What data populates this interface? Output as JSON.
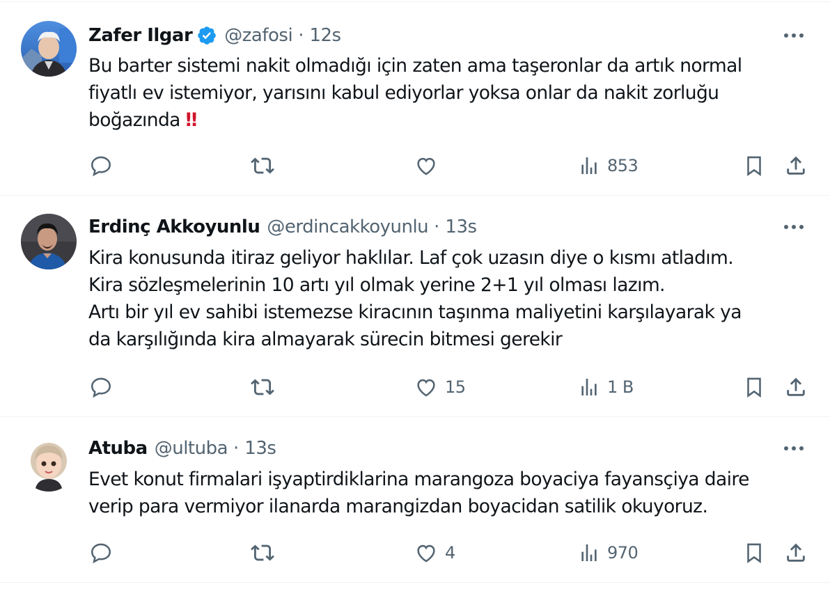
{
  "tweets": [
    {
      "name": "Zafer Ilgar",
      "verified": true,
      "handle": "@zafosi",
      "separator": "·",
      "time": "12s",
      "text": "Bu barter sistemi nakit olmadığı için zaten ama taşeronlar da artık normal\nfiyatlı ev istemiyor, yarısını kabul ediyorlar yoksa onlar da nakit zorluğu\nboğazında ",
      "emoji": "‼",
      "replies": "",
      "reposts": "",
      "likes": "",
      "views": "853"
    },
    {
      "name": "Erdinç Akkoyunlu",
      "verified": false,
      "handle": "@erdincakkoyunlu",
      "separator": "·",
      "time": "13s",
      "text": "Kira konusunda itiraz geliyor haklılar. Laf çok uzasın diye o kısmı atladım.\nKira sözleşmelerinin 10 artı yıl olmak yerine 2+1 yıl olması lazım.\nArtı bir yıl ev sahibi istemezse kiracının taşınma maliyetini karşılayarak ya\nda karşılığında kira almayarak sürecin bitmesi gerekir",
      "emoji": "",
      "replies": "",
      "reposts": "",
      "likes": "15",
      "views": "1 B"
    },
    {
      "name": "Atuba",
      "verified": false,
      "handle": "@ultuba",
      "separator": "·",
      "time": "13s",
      "text": "Evet konut firmalari işyaptirdiklarina marangoza boyaciya fayansçiya daire\nverip para vermiyor ilanarda marangizdan boyacidan satilik okuyoruz.",
      "emoji": "",
      "replies": "",
      "reposts": "",
      "likes": "4",
      "views": "970"
    }
  ],
  "icons": {
    "more": "more-icon",
    "reply": "reply-icon",
    "repost": "repost-icon",
    "like": "like-icon",
    "views": "views-icon",
    "bookmark": "bookmark-icon",
    "share": "share-icon",
    "verified": "verified-badge-icon"
  },
  "colors": {
    "text": "#0f1419",
    "secondary": "#536471",
    "verified": "#1d9bf0",
    "divider": "#eff3f4",
    "emoji": "#d0152c"
  }
}
